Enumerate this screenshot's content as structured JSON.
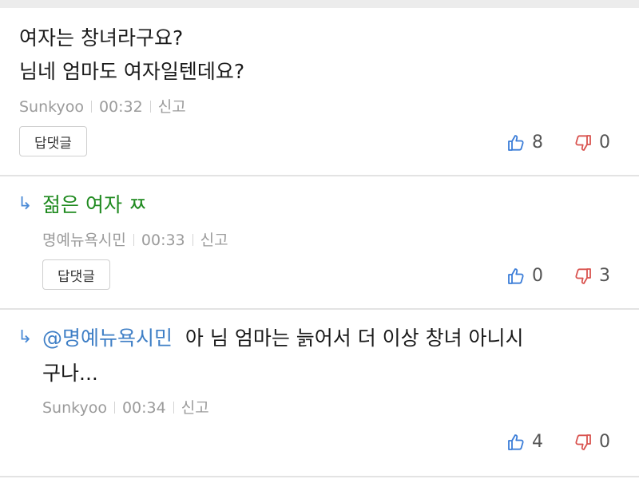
{
  "comments": [
    {
      "text_line1": "여자는 창녀라구요?",
      "text_line2": "님네 엄마도 여자일텐데요?",
      "author": "Sunkyoo",
      "time": "00:32",
      "report_label": "신고",
      "reply_label": "답댓글",
      "likes": "8",
      "dislikes": "0"
    },
    {
      "text": "젊은 여자 ㅉ",
      "author": "명예뉴욕시민",
      "time": "00:33",
      "report_label": "신고",
      "reply_label": "답댓글",
      "likes": "0",
      "dislikes": "3",
      "reply_arrow": "↳"
    },
    {
      "mention": "@명예뉴욕시민",
      "text_line1": "아 님 엄마는 늙어서 더 이상 창녀 아니시",
      "text_line2": "구나...",
      "author": "Sunkyoo",
      "time": "00:34",
      "report_label": "신고",
      "likes": "4",
      "dislikes": "0",
      "reply_arrow": "↳"
    }
  ],
  "colors": {
    "reply_green": "#1f8a1f",
    "mention_blue": "#3f7fc6",
    "like_blue": "#3b7dd8",
    "dislike_red": "#d9534f"
  }
}
